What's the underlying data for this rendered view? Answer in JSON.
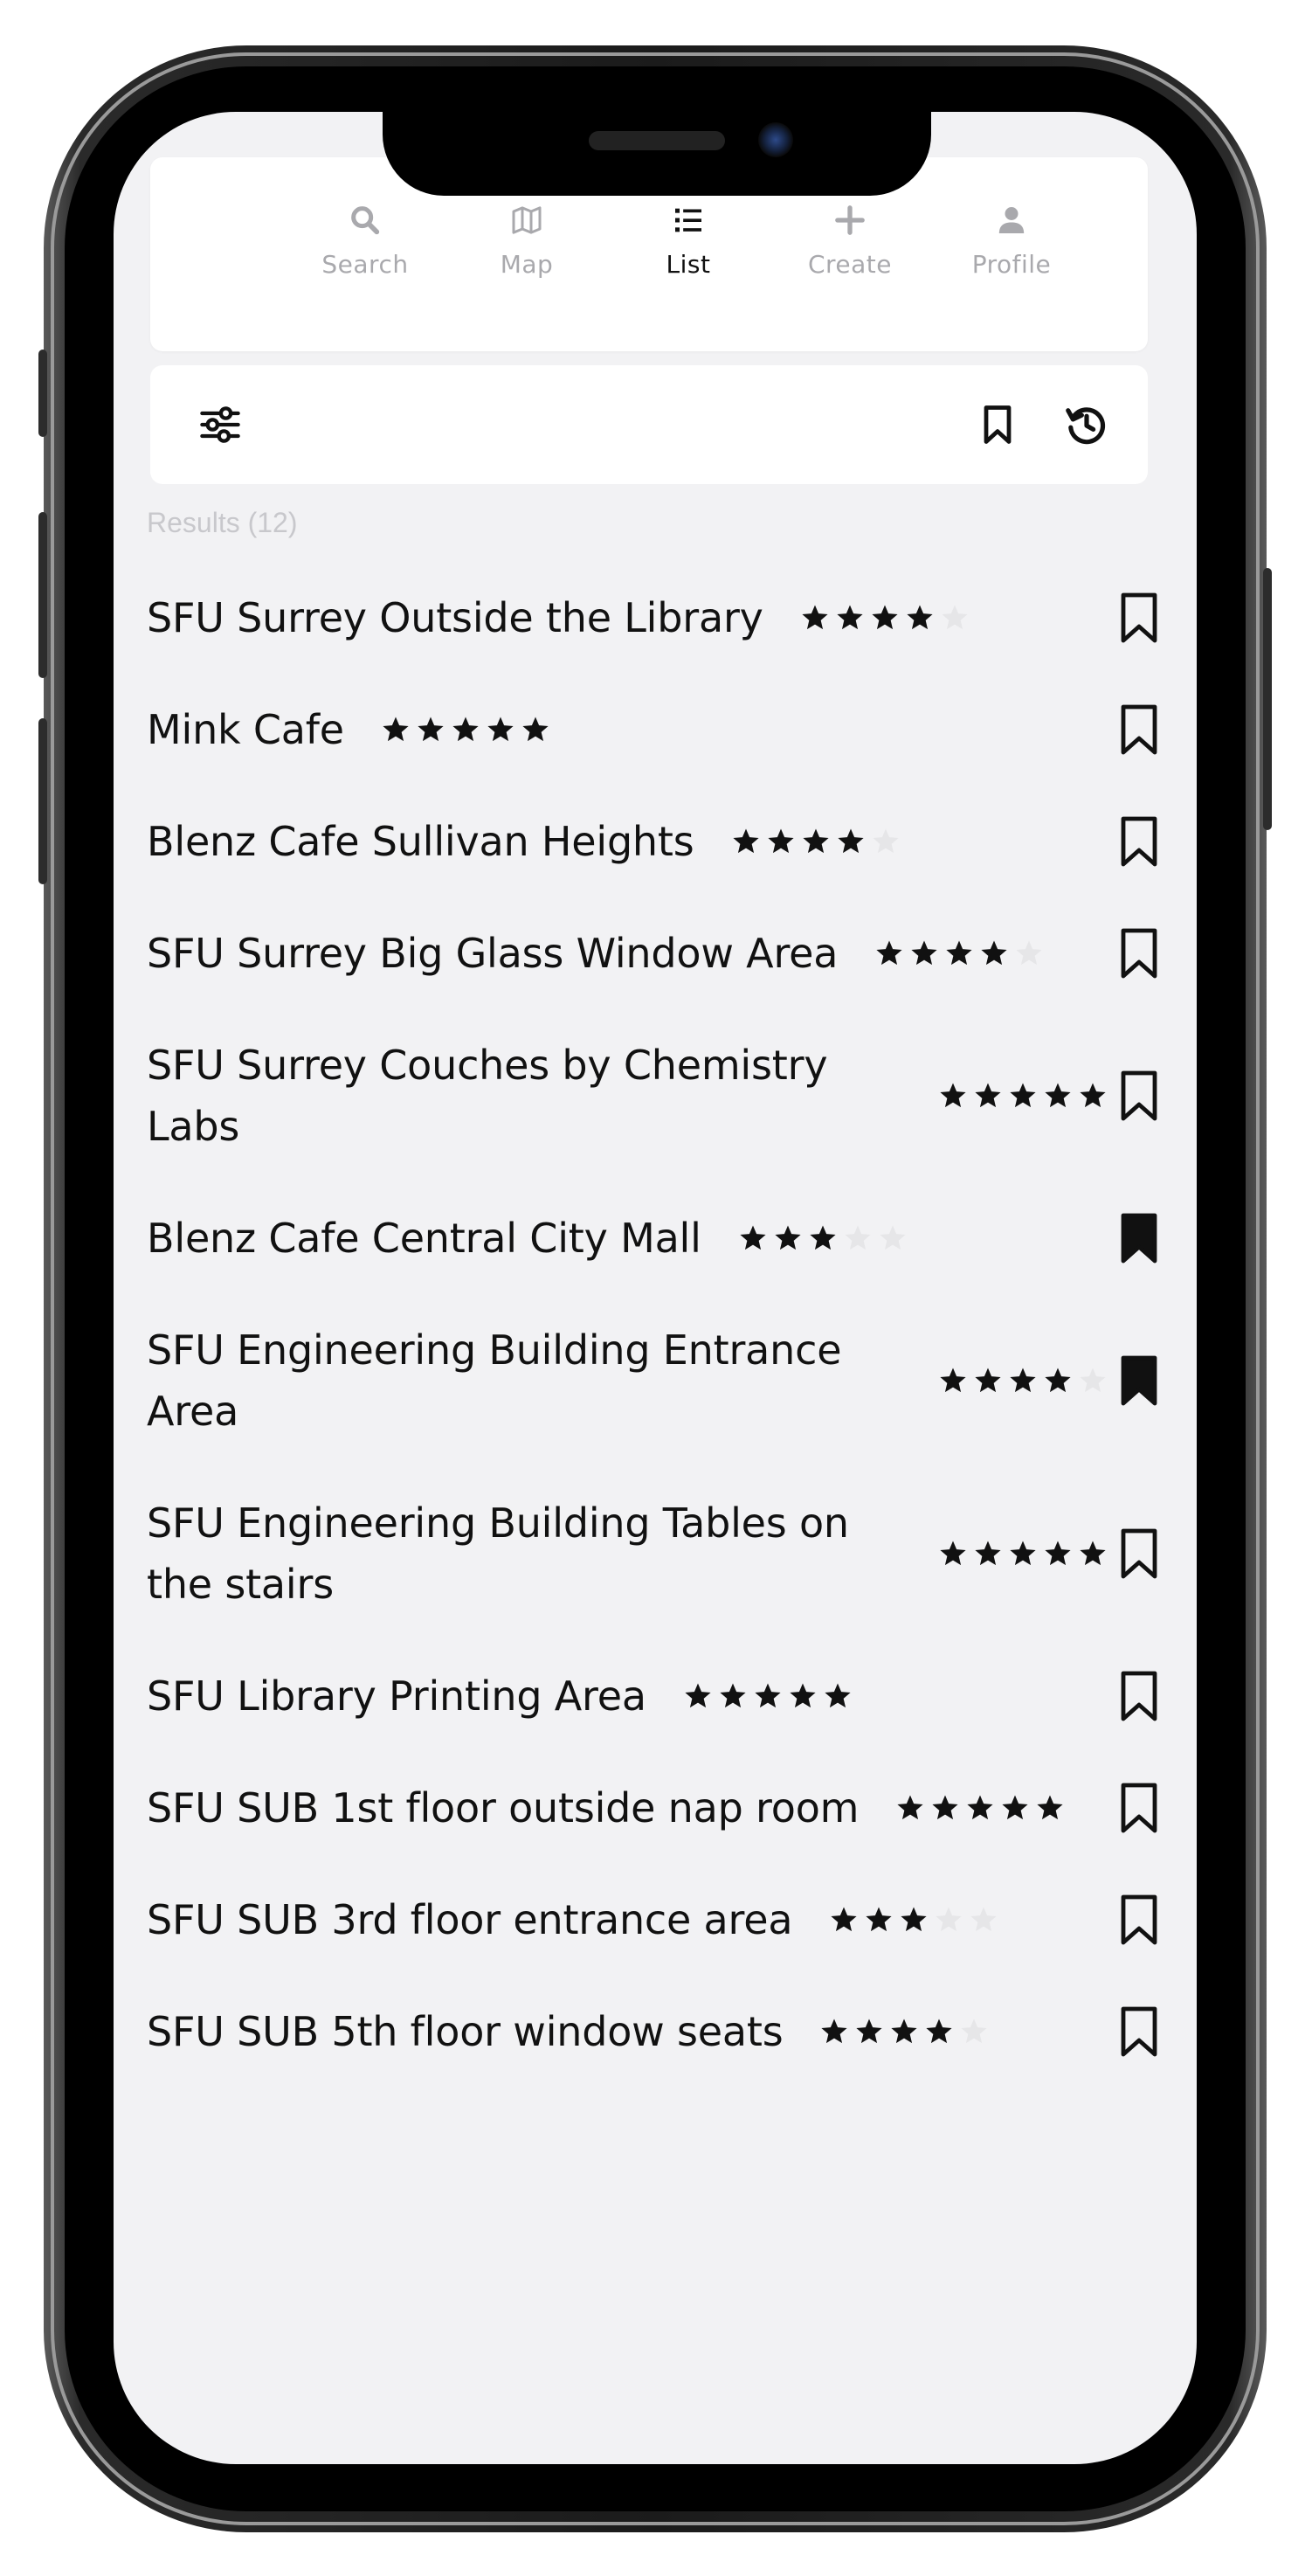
{
  "nav": {
    "tabs": [
      {
        "label": "Search",
        "icon": "search-icon",
        "active": false
      },
      {
        "label": "Map",
        "icon": "map-icon",
        "active": false
      },
      {
        "label": "List",
        "icon": "list-icon",
        "active": true
      },
      {
        "label": "Create",
        "icon": "plus-icon",
        "active": false
      },
      {
        "label": "Profile",
        "icon": "user-icon",
        "active": false
      }
    ]
  },
  "toolbar": {
    "filter_icon": "sliders-icon",
    "bookmarks_icon": "bookmark-icon",
    "history_icon": "history-icon"
  },
  "results": {
    "count_label": "Results (12)",
    "items": [
      {
        "name": "SFU Surrey Outside the Library",
        "rating": 4,
        "bookmarked": false
      },
      {
        "name": "Mink Cafe",
        "rating": 5,
        "bookmarked": false
      },
      {
        "name": "Blenz Cafe Sullivan Heights",
        "rating": 4,
        "bookmarked": false
      },
      {
        "name": "SFU Surrey Big Glass Window Area",
        "rating": 4,
        "bookmarked": false
      },
      {
        "name_line1": "SFU Surrey Couches by Chemistry",
        "name_line2": "Labs",
        "rating": 5,
        "bookmarked": false
      },
      {
        "name": "Blenz Cafe Central City Mall",
        "rating": 3,
        "bookmarked": true
      },
      {
        "name_line1": "SFU Engineering Building Entrance",
        "name_line2": "Area",
        "rating": 4,
        "bookmarked": true
      },
      {
        "name_line1": "SFU Engineering Building Tables on",
        "name_line2": "the stairs",
        "rating": 5,
        "bookmarked": false
      },
      {
        "name": "SFU Library Printing Area",
        "rating": 5,
        "bookmarked": false
      },
      {
        "name": "SFU SUB 1st floor outside nap room",
        "rating": 5,
        "bookmarked": false
      },
      {
        "name": "SFU SUB 3rd floor entrance area",
        "rating": 3,
        "bookmarked": false
      },
      {
        "name": "SFU SUB 5th floor window seats",
        "rating": 4,
        "bookmarked": false
      }
    ]
  },
  "colors": {
    "star_filled": "#111111",
    "star_empty": "#e6e6e8",
    "screen_bg": "#f2f2f4",
    "inactive_tab": "#a9a9ad"
  }
}
